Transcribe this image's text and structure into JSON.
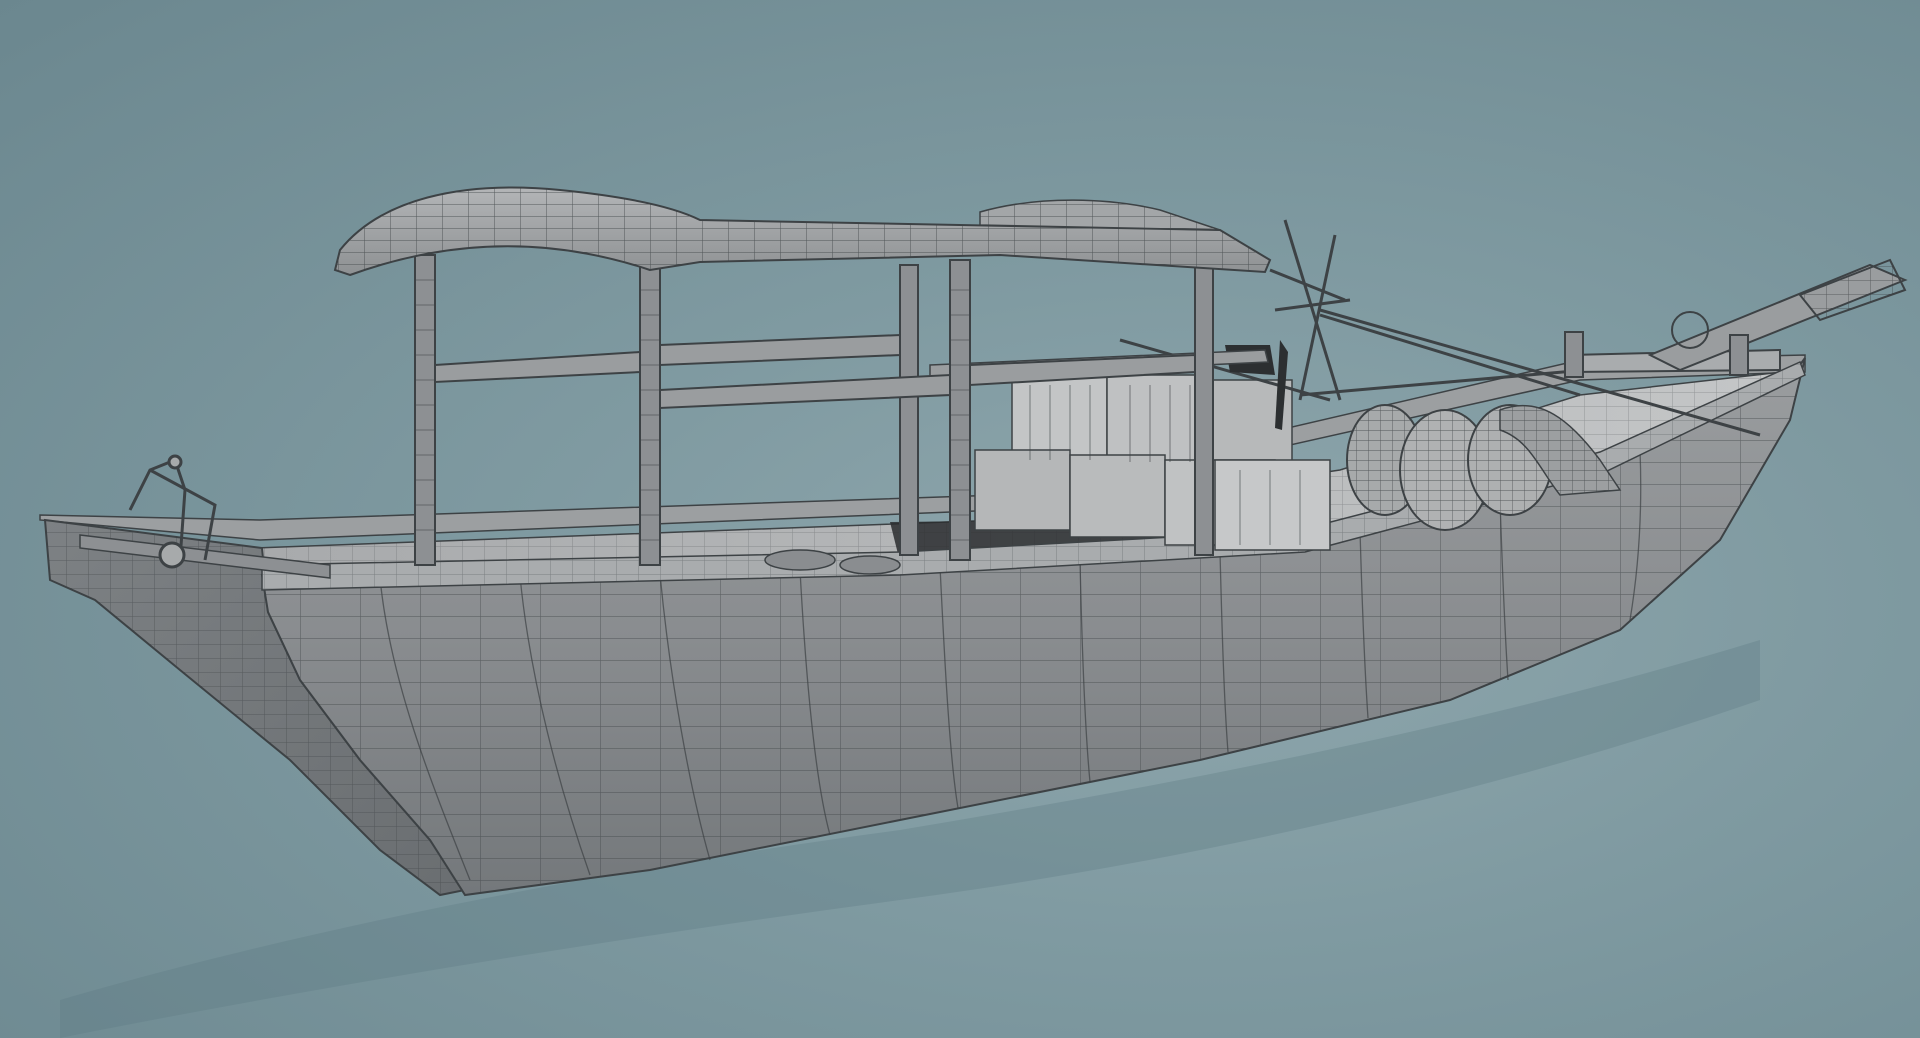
{
  "scene": {
    "subject": "wireframe-boat-render",
    "colors": {
      "background_center": "#8fa7ad",
      "background_edge": "#6b878f",
      "shadow": "#5f7b83",
      "hull": "#8d9093",
      "hull_light": "#a9acae",
      "deck": "#b9bbbc",
      "wire": "#3d4245",
      "canopy": "#9a9d9f",
      "crate": "#c3c5c6",
      "basket": "#a7aaab",
      "flag": "#2c2f31"
    },
    "objects": [
      "hull",
      "deck",
      "canopy-roof",
      "canopy-posts",
      "cargo-crates",
      "wicker-baskets",
      "fishing-net",
      "rudder-oar",
      "bow-winch",
      "mast-rigging",
      "flag"
    ]
  }
}
